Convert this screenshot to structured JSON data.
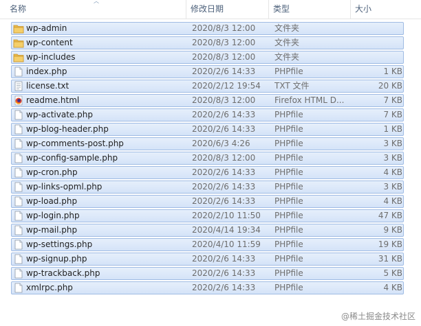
{
  "header": {
    "name": "名称",
    "date": "修改日期",
    "type": "类型",
    "size": "大小"
  },
  "files": [
    {
      "icon": "folder-icon",
      "name": "wp-admin",
      "date": "2020/8/3 12:00",
      "type": "文件夹",
      "size": ""
    },
    {
      "icon": "folder-icon",
      "name": "wp-content",
      "date": "2020/8/3 12:00",
      "type": "文件夹",
      "size": ""
    },
    {
      "icon": "folder-icon",
      "name": "wp-includes",
      "date": "2020/8/3 12:00",
      "type": "文件夹",
      "size": ""
    },
    {
      "icon": "file-icon",
      "name": "index.php",
      "date": "2020/2/6 14:33",
      "type": "PHPfile",
      "size": "1 KB"
    },
    {
      "icon": "text-file-icon",
      "name": "license.txt",
      "date": "2020/2/12 19:54",
      "type": "TXT 文件",
      "size": "20 KB"
    },
    {
      "icon": "firefox-icon",
      "name": "readme.html",
      "date": "2020/8/3 12:00",
      "type": "Firefox HTML D...",
      "size": "7 KB"
    },
    {
      "icon": "file-icon",
      "name": "wp-activate.php",
      "date": "2020/2/6 14:33",
      "type": "PHPfile",
      "size": "7 KB"
    },
    {
      "icon": "file-icon",
      "name": "wp-blog-header.php",
      "date": "2020/2/6 14:33",
      "type": "PHPfile",
      "size": "1 KB"
    },
    {
      "icon": "file-icon",
      "name": "wp-comments-post.php",
      "date": "2020/6/3 4:26",
      "type": "PHPfile",
      "size": "3 KB"
    },
    {
      "icon": "file-icon",
      "name": "wp-config-sample.php",
      "date": "2020/8/3 12:00",
      "type": "PHPfile",
      "size": "3 KB"
    },
    {
      "icon": "file-icon",
      "name": "wp-cron.php",
      "date": "2020/2/6 14:33",
      "type": "PHPfile",
      "size": "4 KB"
    },
    {
      "icon": "file-icon",
      "name": "wp-links-opml.php",
      "date": "2020/2/6 14:33",
      "type": "PHPfile",
      "size": "3 KB"
    },
    {
      "icon": "file-icon",
      "name": "wp-load.php",
      "date": "2020/2/6 14:33",
      "type": "PHPfile",
      "size": "4 KB"
    },
    {
      "icon": "file-icon",
      "name": "wp-login.php",
      "date": "2020/2/10 11:50",
      "type": "PHPfile",
      "size": "47 KB"
    },
    {
      "icon": "file-icon",
      "name": "wp-mail.php",
      "date": "2020/4/14 19:34",
      "type": "PHPfile",
      "size": "9 KB"
    },
    {
      "icon": "file-icon",
      "name": "wp-settings.php",
      "date": "2020/4/10 11:59",
      "type": "PHPfile",
      "size": "19 KB"
    },
    {
      "icon": "file-icon",
      "name": "wp-signup.php",
      "date": "2020/2/6 14:33",
      "type": "PHPfile",
      "size": "31 KB"
    },
    {
      "icon": "file-icon",
      "name": "wp-trackback.php",
      "date": "2020/2/6 14:33",
      "type": "PHPfile",
      "size": "5 KB"
    },
    {
      "icon": "file-icon",
      "name": "xmlrpc.php",
      "date": "2020/2/6 14:33",
      "type": "PHPfile",
      "size": "4 KB"
    }
  ],
  "watermark": "@稀土掘金技术社区",
  "colors": {
    "selection": "#d4e3f8",
    "selection_border": "#9fbbe3",
    "folder": "#e8b84a",
    "header_text": "#4c607a"
  }
}
